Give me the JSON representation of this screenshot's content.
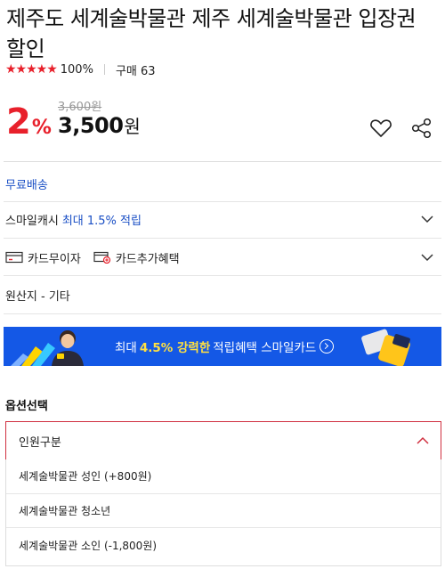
{
  "product": {
    "title": "제주도 세계술박물관 제주 세계술박물관 입장권 할인",
    "stars": "★★★★★",
    "rating_percent": "100%",
    "purchase_label": "구매 63",
    "discount_num": "2",
    "discount_unit": "%",
    "original_price": "3,600원",
    "price_num": "3,500",
    "price_unit": "원"
  },
  "info": {
    "free_shipping": "무료배송",
    "smilecash_label": "스마일캐시",
    "smilecash_value": "최대 1.5% 적립",
    "card_interest_free": "카드무이자",
    "card_extra_benefit": "카드추가혜택",
    "origin": "원산지 - 기타"
  },
  "banner": {
    "prefix": "최대",
    "highlight": "4.5% 강력한",
    "suffix": "적립혜택 스마일카드"
  },
  "options": {
    "title": "옵션선택",
    "select_label": "인원구분",
    "items": [
      "세계술박물관 성인 (+800원)",
      "세계술박물관 청소년",
      "세계술박물관 소인 (-1,800원)"
    ]
  },
  "colors": {
    "accent_red": "#e8202b",
    "link_blue": "#1a4fc5",
    "banner_blue": "#1458e6"
  }
}
